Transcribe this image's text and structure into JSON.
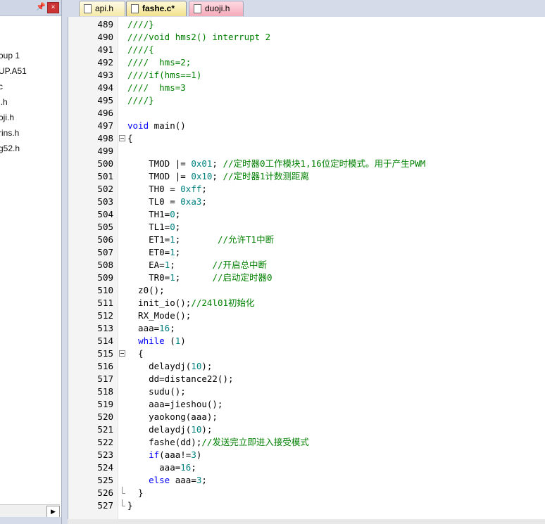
{
  "project_panel": {
    "items": [
      "oup 1",
      "UP.A51",
      "c",
      "i.h",
      "oji.h",
      "rins.h",
      "g52.h"
    ],
    "pin_glyph": "📌",
    "close_glyph": "×"
  },
  "tabs": [
    {
      "label": "api.h",
      "icon": "header-file-icon"
    },
    {
      "label": "fashe.c*",
      "icon": "c-file-icon",
      "active": true
    },
    {
      "label": "duoji.h",
      "icon": "header-file-icon"
    }
  ],
  "colors": {
    "comment": "#008000",
    "keyword": "#0000ff",
    "number": "#008080"
  },
  "editor": {
    "lines": [
      {
        "n": "489",
        "t": "////}"
      },
      {
        "n": "490",
        "t": "////void hms2() interrupt 2"
      },
      {
        "n": "491",
        "t": "////{"
      },
      {
        "n": "492",
        "t": "////  hms=2;"
      },
      {
        "n": "493",
        "t": "////if(hms==1)"
      },
      {
        "n": "494",
        "t": "////  hms=3"
      },
      {
        "n": "495",
        "t": "////}"
      },
      {
        "n": "496",
        "t": ""
      },
      {
        "n": "497",
        "t": "void main()"
      },
      {
        "n": "498",
        "t": "{",
        "fold": "open"
      },
      {
        "n": "499",
        "t": ""
      },
      {
        "n": "500",
        "t": "    TMOD |= 0x01; //定时器0工作模块1,16位定时模式。用于产生PWM"
      },
      {
        "n": "501",
        "t": "    TMOD |= 0x10; //定时器1计数测距离"
      },
      {
        "n": "502",
        "t": "    TH0 = 0xff;"
      },
      {
        "n": "503",
        "t": "    TL0 = 0xa3;"
      },
      {
        "n": "504",
        "t": "    TH1=0;"
      },
      {
        "n": "505",
        "t": "    TL1=0;"
      },
      {
        "n": "506",
        "t": "    ET1=1;       //允许T1中断"
      },
      {
        "n": "507",
        "t": "    ET0=1;"
      },
      {
        "n": "508",
        "t": "    EA=1;       //开启总中断"
      },
      {
        "n": "509",
        "t": "    TR0=1;      //启动定时器0"
      },
      {
        "n": "510",
        "t": "  z0();"
      },
      {
        "n": "511",
        "t": "  init_io();//24l01初始化"
      },
      {
        "n": "512",
        "t": "  RX_Mode();"
      },
      {
        "n": "513",
        "t": "  aaa=16;"
      },
      {
        "n": "514",
        "t": "  while (1)"
      },
      {
        "n": "515",
        "t": "  {",
        "fold": "open"
      },
      {
        "n": "516",
        "t": "    delaydj(10);"
      },
      {
        "n": "517",
        "t": "    dd=distance22();"
      },
      {
        "n": "518",
        "t": "    sudu();"
      },
      {
        "n": "519",
        "t": "    aaa=jieshou();"
      },
      {
        "n": "520",
        "t": "    yaokong(aaa);"
      },
      {
        "n": "521",
        "t": "    delaydj(10);"
      },
      {
        "n": "522",
        "t": "    fashe(dd);//发送完立即进入接受模式"
      },
      {
        "n": "523",
        "t": "    if(aaa!=3)"
      },
      {
        "n": "524",
        "t": "      aaa=16;"
      },
      {
        "n": "525",
        "t": "    else aaa=3;"
      },
      {
        "n": "526",
        "t": "  }",
        "fold": "end"
      },
      {
        "n": "527",
        "t": "}",
        "fold": "end"
      }
    ]
  }
}
